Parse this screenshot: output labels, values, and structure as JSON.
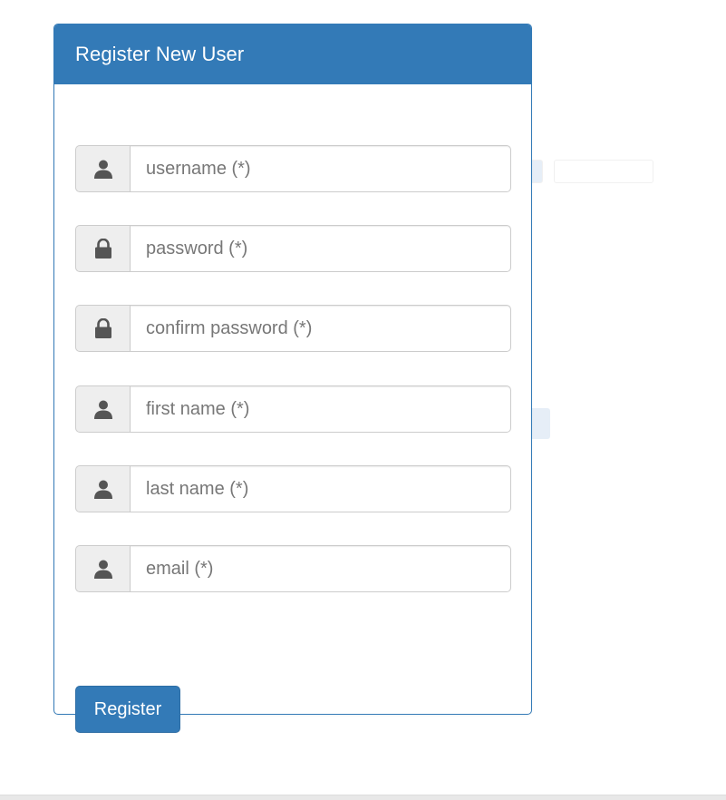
{
  "panel": {
    "title": "Register New User"
  },
  "form": {
    "fields": [
      {
        "name": "username",
        "placeholder": "username (*)",
        "value": "",
        "icon": "user-icon",
        "type": "text"
      },
      {
        "name": "password",
        "placeholder": "password (*)",
        "value": "",
        "icon": "lock-icon",
        "type": "password"
      },
      {
        "name": "confirm-password",
        "placeholder": "confirm password (*)",
        "value": "",
        "icon": "lock-icon",
        "type": "password"
      },
      {
        "name": "first-name",
        "placeholder": "first name (*)",
        "value": "",
        "icon": "user-icon",
        "type": "text"
      },
      {
        "name": "last-name",
        "placeholder": "last name (*)",
        "value": "",
        "icon": "user-icon",
        "type": "text"
      },
      {
        "name": "email",
        "placeholder": "email (*)",
        "value": "",
        "icon": "user-icon",
        "type": "text"
      }
    ],
    "submit_label": "Register"
  },
  "colors": {
    "primary": "#337ab7",
    "addon_bg": "#eeeeee",
    "border": "#cccccc",
    "icon": "#555555"
  }
}
